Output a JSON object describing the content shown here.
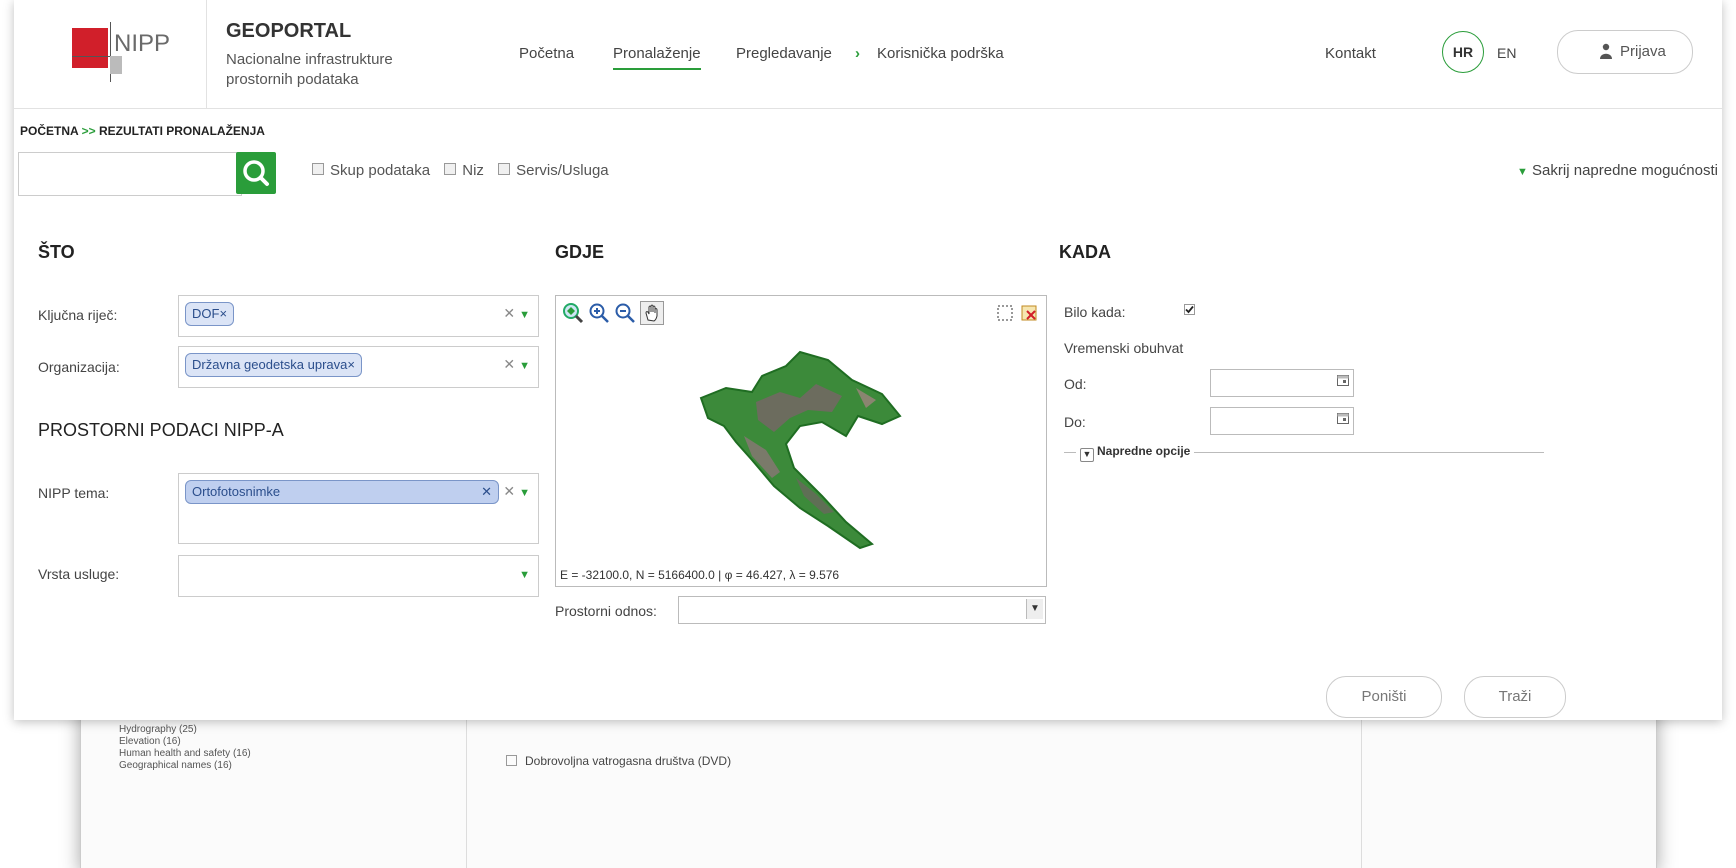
{
  "header": {
    "logo_text": "NIPP",
    "site_title": "GEOPORTAL",
    "site_subtitle_1": "Nacionalne infrastrukture",
    "site_subtitle_2": "prostornih podataka",
    "nav": [
      "Početna",
      "Pronalaženje",
      "Pregledavanje",
      "Korisnička podrška"
    ],
    "contact": "Kontakt",
    "lang_hr": "HR",
    "lang_en": "EN",
    "login": "Prijava"
  },
  "breadcrumb": {
    "home": "POČETNA",
    "separator": ">>",
    "current": "REZULTATI PRONALAŽENJA"
  },
  "search": {
    "value": "",
    "types": [
      "Skup podataka",
      "Niz",
      "Servis/Usluga"
    ],
    "advanced_toggle": "Sakrij napredne mogućnosti"
  },
  "sto": {
    "title": "ŠTO",
    "keyword_label": "Ključna riječ:",
    "keyword_tag": "DOF",
    "org_label": "Organizacija:",
    "org_tag": "Državna geodetska uprava"
  },
  "nipp": {
    "title": "PROSTORNI PODACI NIPP-A",
    "theme_label": "NIPP tema:",
    "theme_tag": "Ortofotosnimke",
    "service_label": "Vrsta usluge:"
  },
  "gdje": {
    "title": "GDJE",
    "coords": "E = -32100.0, N = 5166400.0 | φ = 46.427, λ = 9.576",
    "relation_label": "Prostorni odnos:",
    "relation_value": ""
  },
  "kada": {
    "title": "KADA",
    "anytime_label": "Bilo kada:",
    "range_label": "Vremenski obuhvat",
    "from_label": "Od:",
    "to_label": "Do:",
    "advanced_options": "Napredne opcije"
  },
  "buttons": {
    "reset": "Poništi",
    "search": "Traži"
  },
  "background_page": {
    "categories": [
      "Hydrography (25)",
      "Elevation (16)",
      "Human health and safety (16)",
      "Geographical names (16)"
    ],
    "result_item": "Dobrovoljna vatrogasna društva (DVD)"
  },
  "colors": {
    "accent": "#2a9d3a",
    "logo_red": "#d11f2a",
    "tag_blue": "#dbe4f6"
  }
}
